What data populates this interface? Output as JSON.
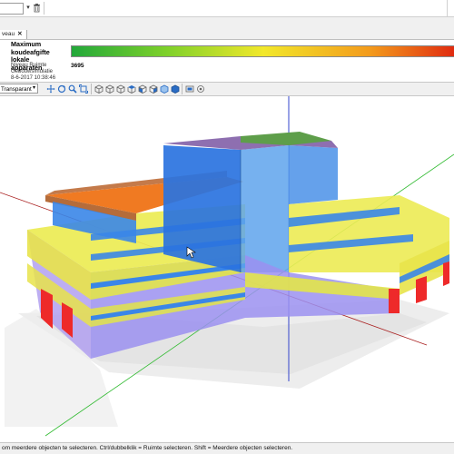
{
  "tab": {
    "label": "veau",
    "close": "✕"
  },
  "legend": {
    "title_lines": [
      "Maximum",
      "koudeafgifte",
      "lokale",
      "apparaten"
    ],
    "meta_lines": [
      "Niveau   Ruimte",
      "Gebouwsimulatie",
      "8-6-2017 10:38:46"
    ],
    "value": "3695",
    "colors": [
      "#22a83a",
      "#7fd12a",
      "#f2e82a",
      "#f39a1c",
      "#e02a10"
    ]
  },
  "toolbar": {
    "display_mode": "Transparant"
  },
  "status": {
    "text": "om meerdere objecten te selecteren. Ctrl/dubbelklik = Ruimte selecteren. Shift = Meerdere objecten selecteren."
  },
  "icons": [
    "dropdown-arrow-icon",
    "trash-icon",
    "pan-icon",
    "orbit-icon",
    "zoom-icon",
    "zoom-extents-icon",
    "cube-view-icon",
    "front-view-icon",
    "side-view-icon",
    "top-view-icon",
    "iso-view-icon",
    "shading-icon",
    "render-icon",
    "settings-icon"
  ]
}
